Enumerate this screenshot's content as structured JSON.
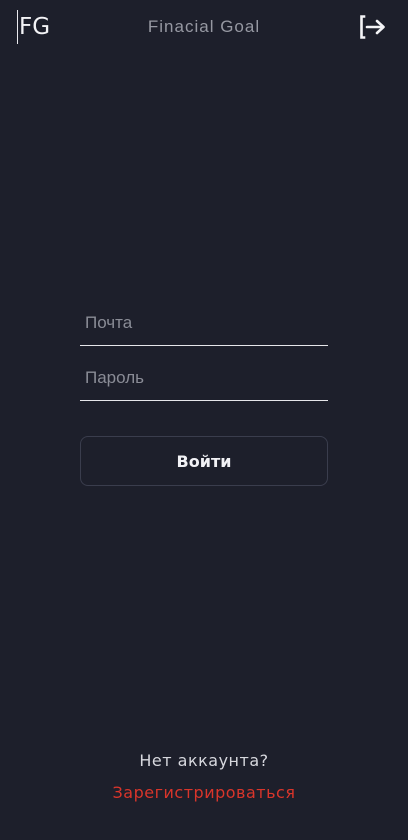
{
  "header": {
    "logo_text": "FG",
    "title": "Finacial Goal",
    "logout_icon": "logout-icon"
  },
  "login_form": {
    "email_placeholder": "Почта",
    "email_value": "",
    "password_placeholder": "Пароль",
    "password_value": "",
    "submit_label": "Войти"
  },
  "footer": {
    "no_account_text": "Нет аккаунта?",
    "register_link": "Зарегистрироваться"
  },
  "colors": {
    "background": "#1d1f2b",
    "accent_link": "#d9352b",
    "text_primary": "#f2f2f6",
    "text_muted": "#8a8c96"
  }
}
